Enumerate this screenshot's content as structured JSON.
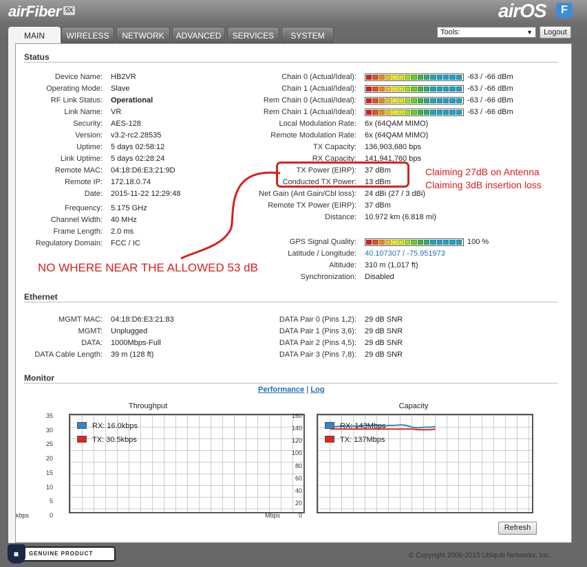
{
  "header": {
    "brand_left": "airFiber",
    "brand_left_sub": "5X",
    "brand_right": "airOS",
    "brand_right_badge": "F"
  },
  "tabs": [
    "MAIN",
    "WIRELESS",
    "NETWORK",
    "ADVANCED",
    "SERVICES",
    "SYSTEM"
  ],
  "toolbar": {
    "tools_label": "Tools:",
    "logout_label": "Logout"
  },
  "status": {
    "title": "Status",
    "left": [
      {
        "label": "Device Name:",
        "value": "HB2VR"
      },
      {
        "label": "Operating Mode:",
        "value": "Slave"
      },
      {
        "label": "RF Link Status:",
        "value": "Operational"
      },
      {
        "label": "Link Name:",
        "value": "VR"
      },
      {
        "label": "Security:",
        "value": "AES-128"
      },
      {
        "label": "Version:",
        "value": "v3.2-rc2.28535"
      },
      {
        "label": "Uptime:",
        "value": "5 days 02:58:12"
      },
      {
        "label": "Link Uptime:",
        "value": "5 days 02:28:24"
      },
      {
        "label": "Remote MAC:",
        "value": "04:18:D6:E3:21:9D"
      },
      {
        "label": "Remote IP:",
        "value": "172.18.0.74"
      },
      {
        "label": "Date:",
        "value": "2015-11-22 12:29:48"
      },
      {
        "label": "Frequency:",
        "value": "5.175 GHz"
      },
      {
        "label": "Channel Width:",
        "value": "40 MHz"
      },
      {
        "label": "Frame Length:",
        "value": "2.0 ms"
      },
      {
        "label": "Regulatory Domain:",
        "value": "FCC / IC"
      }
    ],
    "chains": [
      {
        "label": "Chain 0 (Actual/Ideal):",
        "value": "-63 / -66 dBm"
      },
      {
        "label": "Chain 1 (Actual/Ideal):",
        "value": "-63 / -66 dBm"
      },
      {
        "label": "Rem Chain 0 (Actual/Ideal):",
        "value": "-63 / -66 dBm"
      },
      {
        "label": "Rem Chain 1 (Actual/Ideal):",
        "value": "-63 / -66 dBm"
      }
    ],
    "right": [
      {
        "label": "Local Modulation Rate:",
        "value": "6x (64QAM MIMO)"
      },
      {
        "label": "Remote Modulation Rate:",
        "value": "6x (64QAM MIMO)"
      },
      {
        "label": "TX Capacity:",
        "value": "136,903,680 bps"
      },
      {
        "label": "RX Capacity:",
        "value": "141,941,760 bps"
      },
      {
        "label": "TX Power (EIRP):",
        "value": "37 dBm"
      },
      {
        "label": "Conducted TX Power:",
        "value": "13 dBm"
      },
      {
        "label": "Net Gain (Ant Gain/Cbl loss):",
        "value": "24 dBi (27 / 3 dBi)"
      },
      {
        "label": "Remote TX Power (EIRP):",
        "value": "37 dBm"
      },
      {
        "label": "Distance:",
        "value": "10.972 km (6.818 mi)"
      }
    ],
    "gps": {
      "label": "GPS Signal Quality:",
      "value": "100 %"
    },
    "right2": [
      {
        "label": "Latitude / Longitude:",
        "value": "40.107307 / -75.951973"
      },
      {
        "label": "Altitude:",
        "value": "310 m (1,017 ft)"
      },
      {
        "label": "Synchronization:",
        "value": "Disabled"
      }
    ]
  },
  "annotations": {
    "line1": "Claiming 27dB on Antenna",
    "line2": "Claiming 3dB insertion loss",
    "big": "NO WHERE NEAR THE ALLOWED 53 dB"
  },
  "ethernet": {
    "title": "Ethernet",
    "left": [
      {
        "label": "MGMT MAC:",
        "value": "04:18:D6:E3:21:83"
      },
      {
        "label": "MGMT:",
        "value": "Unplugged"
      },
      {
        "label": "DATA:",
        "value": "1000Mbps-Full"
      },
      {
        "label": "DATA Cable Length:",
        "value": "39 m (128 ft)"
      }
    ],
    "right": [
      {
        "label": "DATA Pair 0 (Pins 1,2):",
        "value": "29 dB SNR"
      },
      {
        "label": "DATA Pair 1 (Pins 3,6):",
        "value": "29 dB SNR"
      },
      {
        "label": "DATA Pair 2 (Pins 4,5):",
        "value": "29 dB SNR"
      },
      {
        "label": "DATA Pair 3 (Pins 7,8):",
        "value": "29 dB SNR"
      }
    ]
  },
  "monitor": {
    "title": "Monitor",
    "link_performance": "Performance",
    "separator": "|",
    "link_log": "Log",
    "refresh_label": "Refresh"
  },
  "footer": {
    "badge_text": "GENUINE PRODUCT",
    "copyright": "© Copyright 2006-2015 Ubiquiti Networks, Inc."
  },
  "chart_data": [
    {
      "type": "line",
      "title": "Throughput",
      "ylabel": "kbps",
      "yticks": [
        "35",
        "30",
        "25",
        "20",
        "15",
        "10",
        "5",
        "0"
      ],
      "ylim": [
        0,
        35
      ],
      "series": [
        {
          "name": "RX: 16.0kbps",
          "color": "#2e86c8",
          "values": []
        },
        {
          "name": "TX: 30.5kbps",
          "color": "#e2231a",
          "values": []
        }
      ]
    },
    {
      "type": "line",
      "title": "Capacity",
      "ylabel": "Mbps",
      "yticks": [
        "160",
        "140",
        "120",
        "100",
        "80",
        "60",
        "40",
        "20",
        "0"
      ],
      "ylim": [
        0,
        160
      ],
      "series": [
        {
          "name": "RX: 143Mbps",
          "color": "#2e86c8",
          "values": [
            141,
            141,
            142,
            142,
            142,
            142,
            143,
            143,
            143,
            142,
            143,
            143,
            144,
            143,
            140,
            139,
            140,
            140,
            141
          ]
        },
        {
          "name": "TX: 137Mbps",
          "color": "#e2231a",
          "values": [
            137,
            137,
            137,
            137,
            137,
            137,
            137,
            137,
            137,
            137,
            137,
            137,
            137,
            137,
            137,
            136,
            136,
            136,
            137
          ]
        }
      ]
    }
  ]
}
